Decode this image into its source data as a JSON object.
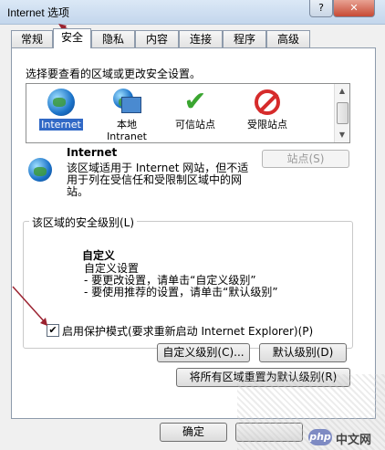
{
  "window": {
    "title": "Internet 选项",
    "help_label": "?",
    "close_label": "✕"
  },
  "tabs": [
    {
      "label": "常规"
    },
    {
      "label": "安全"
    },
    {
      "label": "隐私"
    },
    {
      "label": "内容"
    },
    {
      "label": "连接"
    },
    {
      "label": "程序"
    },
    {
      "label": "高级"
    }
  ],
  "zones": {
    "prompt": "选择要查看的区域或更改安全设置。",
    "items": [
      {
        "label": "Internet",
        "icon": "globe-icon"
      },
      {
        "label": "本地\nIntranet",
        "icon": "local-intranet-icon"
      },
      {
        "label": "可信站点",
        "icon": "checkmark-icon"
      },
      {
        "label": "受限站点",
        "icon": "no-entry-icon"
      }
    ]
  },
  "description": {
    "title": "Internet",
    "text": "该区域适用于 Internet 网站，但不适用于列在受信任和受限制区域中的网站。"
  },
  "sites_button": "站点(S)",
  "security_level": {
    "group_label": "该区域的安全级别(L)",
    "level_title": "自定义",
    "level_text": "自定义设置\n- 要更改设置，请单击“自定义级别”\n- 要使用推荐的设置，请单击“默认级别”"
  },
  "protected_mode": {
    "checked": true,
    "label": "启用保护模式(要求重新启动 Internet Explorer)(P)"
  },
  "buttons": {
    "custom_level": "自定义级别(C)...",
    "default_level": "默认级别(D)",
    "reset_all": "将所有区域重置为默认级别(R)",
    "ok": "确定"
  },
  "watermark": {
    "logo": "php",
    "text": "中文网"
  },
  "colors": {
    "selection": "#3169c6",
    "arrow": "#9b2230"
  }
}
